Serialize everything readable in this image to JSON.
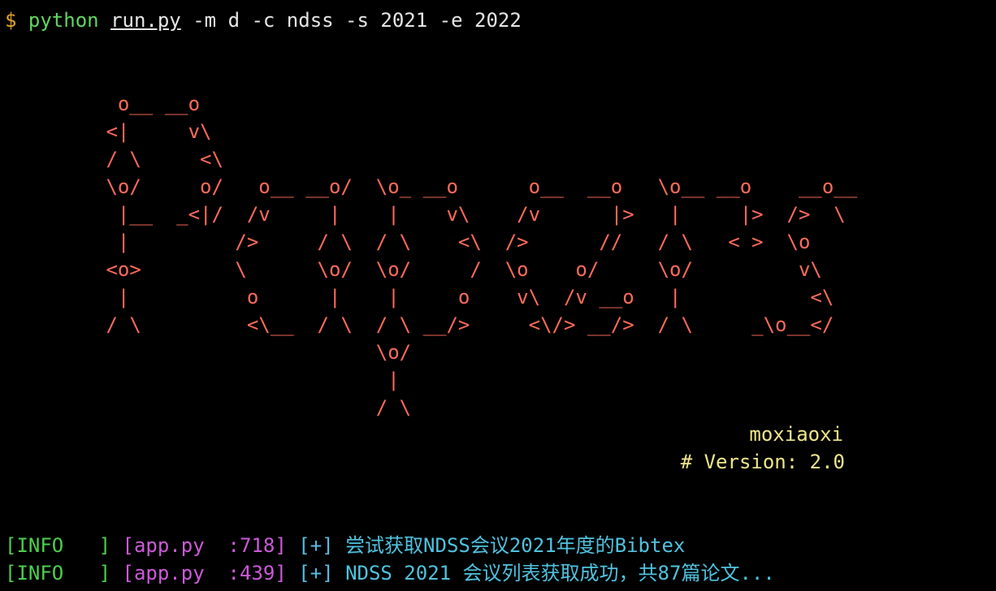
{
  "terminal": {
    "prompt_symbol": "$",
    "command": {
      "executable": "python",
      "script": "run.py",
      "args": " -m d -c ndss -s 2021 -e 2022"
    },
    "banner_lines": [
      "  o__ __o",
      " <|     v\\",
      " / \\     <\\",
      " \\o/     o/   o__ __o/  \\o_ __o      o__  __o   \\o__ __o    __o__",
      "  |__  _<|/  /v     |    |    v\\    /v      |>   |     |>  />  \\",
      "  |         />     / \\  / \\    <\\  />      //   / \\   < >  \\o",
      " <o>        \\      \\o/  \\o/     /  \\o    o/     \\o/         v\\",
      "  |          o      |    |     o    v\\  /v __o   |           <\\",
      " / \\         <\\__  / \\  / \\ __/>     <\\/> __/>  / \\     _\\o__</",
      "                        \\o/",
      "                         |",
      "                        / \\"
    ],
    "author": "moxiaoxi",
    "version": "# Version: 2.0",
    "logs": [
      {
        "level": "[INFO   ]",
        "module": "[app.py  :718]",
        "marker": "[+]",
        "message": "尝试获取NDSS会议2021年度的Bibtex"
      },
      {
        "level": "[INFO   ]",
        "module": "[app.py  :439]",
        "marker": "[+]",
        "message": "NDSS 2021 会议列表获取成功，共87篇论文..."
      }
    ]
  }
}
